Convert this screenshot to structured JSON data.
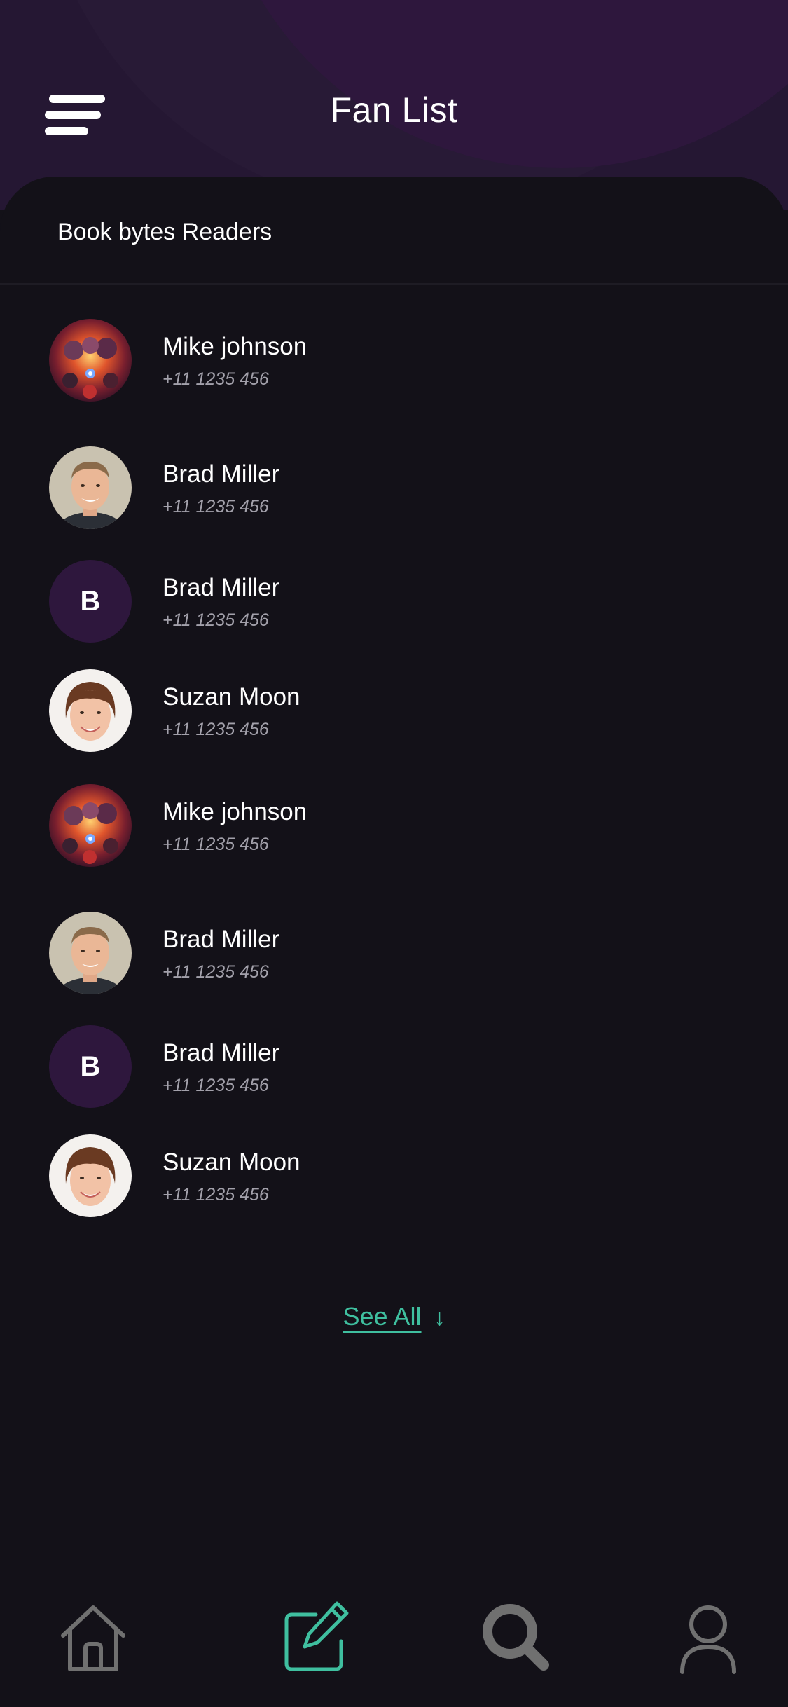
{
  "header": {
    "title": "Fan List"
  },
  "section": {
    "title": "Book bytes Readers"
  },
  "fans": [
    {
      "name": "Mike johnson",
      "phone": "+11 1235 456",
      "avatar": "avengers-poster"
    },
    {
      "name": "Brad Miller",
      "phone": "+11 1235 456",
      "avatar": "man-photo"
    },
    {
      "name": "Brad Miller",
      "phone": "+11 1235 456",
      "avatar": "initial",
      "initial": "B"
    },
    {
      "name": "Suzan Moon",
      "phone": "+11 1235 456",
      "avatar": "woman-photo"
    },
    {
      "name": "Mike johnson",
      "phone": "+11 1235 456",
      "avatar": "avengers-poster"
    },
    {
      "name": "Brad Miller",
      "phone": "+11 1235 456",
      "avatar": "man-photo"
    },
    {
      "name": "Brad Miller",
      "phone": "+11 1235 456",
      "avatar": "initial",
      "initial": "B"
    },
    {
      "name": "Suzan Moon",
      "phone": "+11 1235 456",
      "avatar": "woman-photo"
    }
  ],
  "see_all": {
    "label": "See All",
    "arrow": "↓"
  },
  "bottom_nav": [
    {
      "icon": "home-icon",
      "active": false
    },
    {
      "icon": "edit-icon",
      "active": true
    },
    {
      "icon": "search-icon",
      "active": false
    },
    {
      "icon": "profile-icon",
      "active": false
    }
  ],
  "colors": {
    "background": "#131118",
    "header": "#251733",
    "accent": "#3fbf9f",
    "initial_avatar": "#2e173d",
    "inactive_icon": "#707070"
  }
}
